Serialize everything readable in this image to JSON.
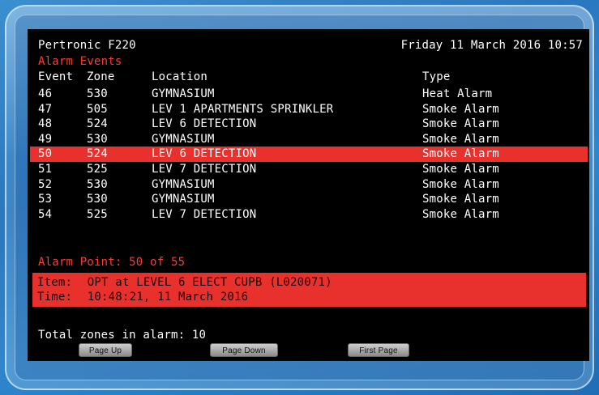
{
  "header": {
    "panel": "Pertronic F220",
    "datetime": "Friday 11 March 2016 10:57"
  },
  "section_title": "Alarm Events",
  "columns": {
    "event": "Event",
    "zone": "Zone",
    "location": "Location",
    "type": "Type"
  },
  "events": [
    {
      "event": "46",
      "zone": "530",
      "location": "GYMNASIUM",
      "type": "Heat Alarm"
    },
    {
      "event": "47",
      "zone": "505",
      "location": "LEV 1 APARTMENTS SPRINKLER",
      "type": "Smoke Alarm"
    },
    {
      "event": "48",
      "zone": "524",
      "location": "LEV 6 DETECTION",
      "type": "Smoke Alarm"
    },
    {
      "event": "49",
      "zone": "530",
      "location": "GYMNASIUM",
      "type": "Smoke Alarm"
    },
    {
      "event": "50",
      "zone": "524",
      "location": "LEV 6 DETECTION",
      "type": "Smoke Alarm"
    },
    {
      "event": "51",
      "zone": "525",
      "location": "LEV 7 DETECTION",
      "type": "Smoke Alarm"
    },
    {
      "event": "52",
      "zone": "530",
      "location": "GYMNASIUM",
      "type": "Smoke Alarm"
    },
    {
      "event": "53",
      "zone": "530",
      "location": "GYMNASIUM",
      "type": "Smoke Alarm"
    },
    {
      "event": "54",
      "zone": "525",
      "location": "LEV 7 DETECTION",
      "type": "Smoke Alarm"
    }
  ],
  "alarm_point": "Alarm Point: 50 of 55",
  "detail": {
    "item_label": "Item:",
    "item_value": "OPT at LEVEL 6 ELECT CUPB   (L020071)",
    "time_label": "Time:",
    "time_value": "10:48:21, 11 March 2016"
  },
  "total_zones": "Total zones in alarm: 10",
  "buttons": {
    "page_up": "Page Up",
    "page_down": "Page Down",
    "first_page": "First Page"
  },
  "colors": {
    "alarm_red": "#e8312d",
    "screen_bg": "#000000",
    "bezel_blue": "#2a78c0"
  }
}
